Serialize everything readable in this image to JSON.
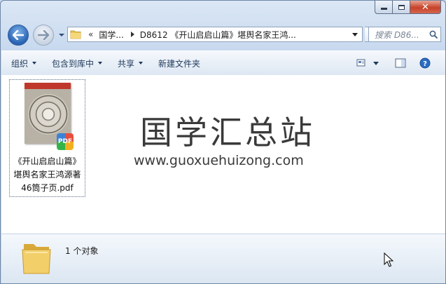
{
  "window": {
    "caption_buttons": [
      "minimize",
      "maximize",
      "close"
    ]
  },
  "address_bar": {
    "overflow": "«",
    "segments": [
      "国学...",
      "D8612 《开山启启山篇》堪舆名家王鸿..."
    ]
  },
  "search": {
    "placeholder": "搜索 D86..."
  },
  "toolbar": {
    "organize": "组织",
    "include_in_library": "包含到库中",
    "share": "共享",
    "new_folder": "新建文件夹"
  },
  "file": {
    "name_lines": [
      "《开山启启山篇》",
      "堪舆名家王鸿源著",
      "46筒子页.pdf"
    ],
    "badge": "PDF",
    "thumb_header": "PDF"
  },
  "watermark": {
    "title": "国学汇总站",
    "url": "www.guoxuehuizong.com"
  },
  "status": {
    "item_count": "1 个对象"
  },
  "colors": {
    "accent": "#2862b3",
    "close": "#c7422a",
    "toolbar_text": "#1e395b"
  }
}
